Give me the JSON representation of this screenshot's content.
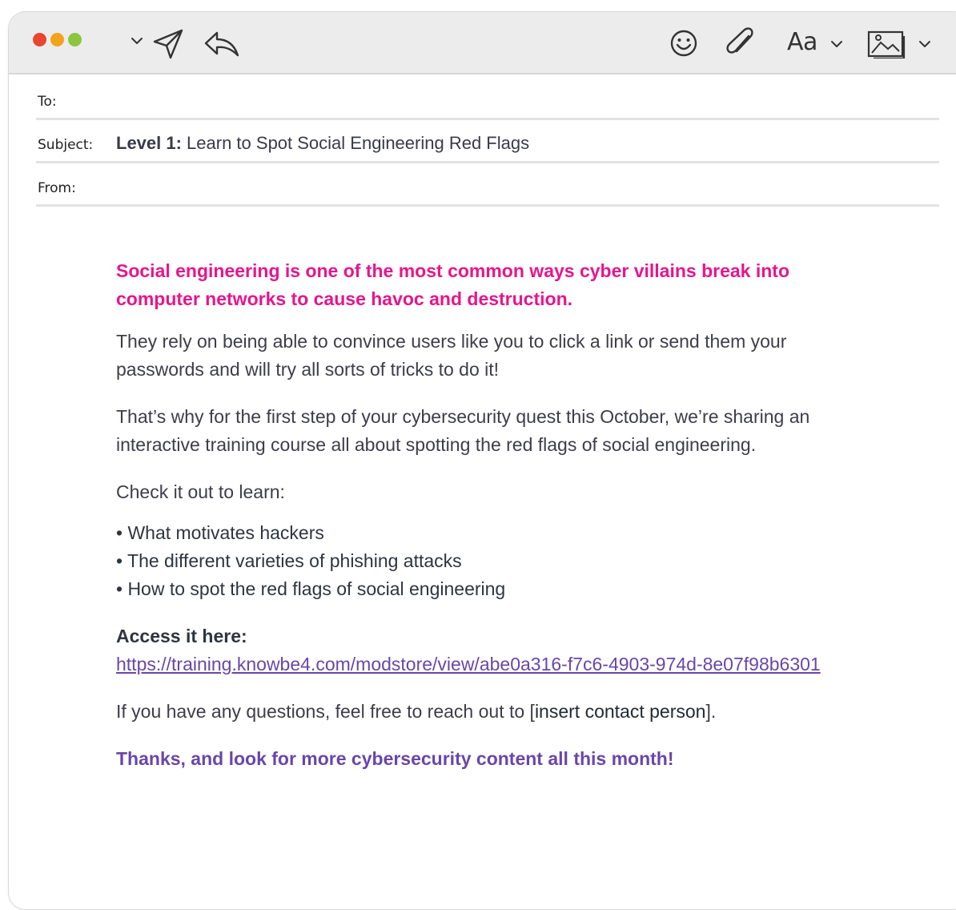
{
  "toolbar": {
    "traffic_lights": {
      "close_color": "#e8462e",
      "minimize_color": "#f3a21b",
      "zoom_color": "#8cc63f"
    },
    "icons": [
      "chevron-down-icon",
      "send-icon",
      "reply-icon",
      "emoji-icon",
      "attachment-icon",
      "image-icon"
    ],
    "format_label": "Aa"
  },
  "header": {
    "to_label": "To:",
    "subject_label": "Subject:",
    "subject_level": "Level 1:",
    "subject_text": " Learn to Spot Social Engineering Red Flags",
    "from_label": "From:"
  },
  "body": {
    "lead": "Social engineering is one of the most common ways cyber villains break into computer networks to cause havoc and destruction.",
    "para1": "They rely on being able to convince users like you to click a link or send them your passwords and will try all sorts of tricks to do it!",
    "para2": "That’s why for the first step of your cybersecurity quest this October, we’re sharing an interactive training course all about spotting the red flags of social engineering.",
    "para3": "Check it out to learn:",
    "bullets": [
      "• What motivates hackers",
      "• The different varieties of phishing attacks",
      "• How to spot the red flags of social engineering"
    ],
    "access_label": "Access it here:",
    "link": "https://training.knowbe4.com/modstore/view/abe0a316-f7c6-4903-974d-8e07f98b6301",
    "contact_prefix": "If you have any questions, feel free to reach out to [",
    "contact_person": "insert contact person",
    "contact_suffix": "].",
    "thanks": "Thanks, and look for more cybersecurity content all this month!"
  },
  "colors": {
    "lead": "#e6168c",
    "link": "#6a46a8",
    "thanks": "#6a46a8"
  }
}
